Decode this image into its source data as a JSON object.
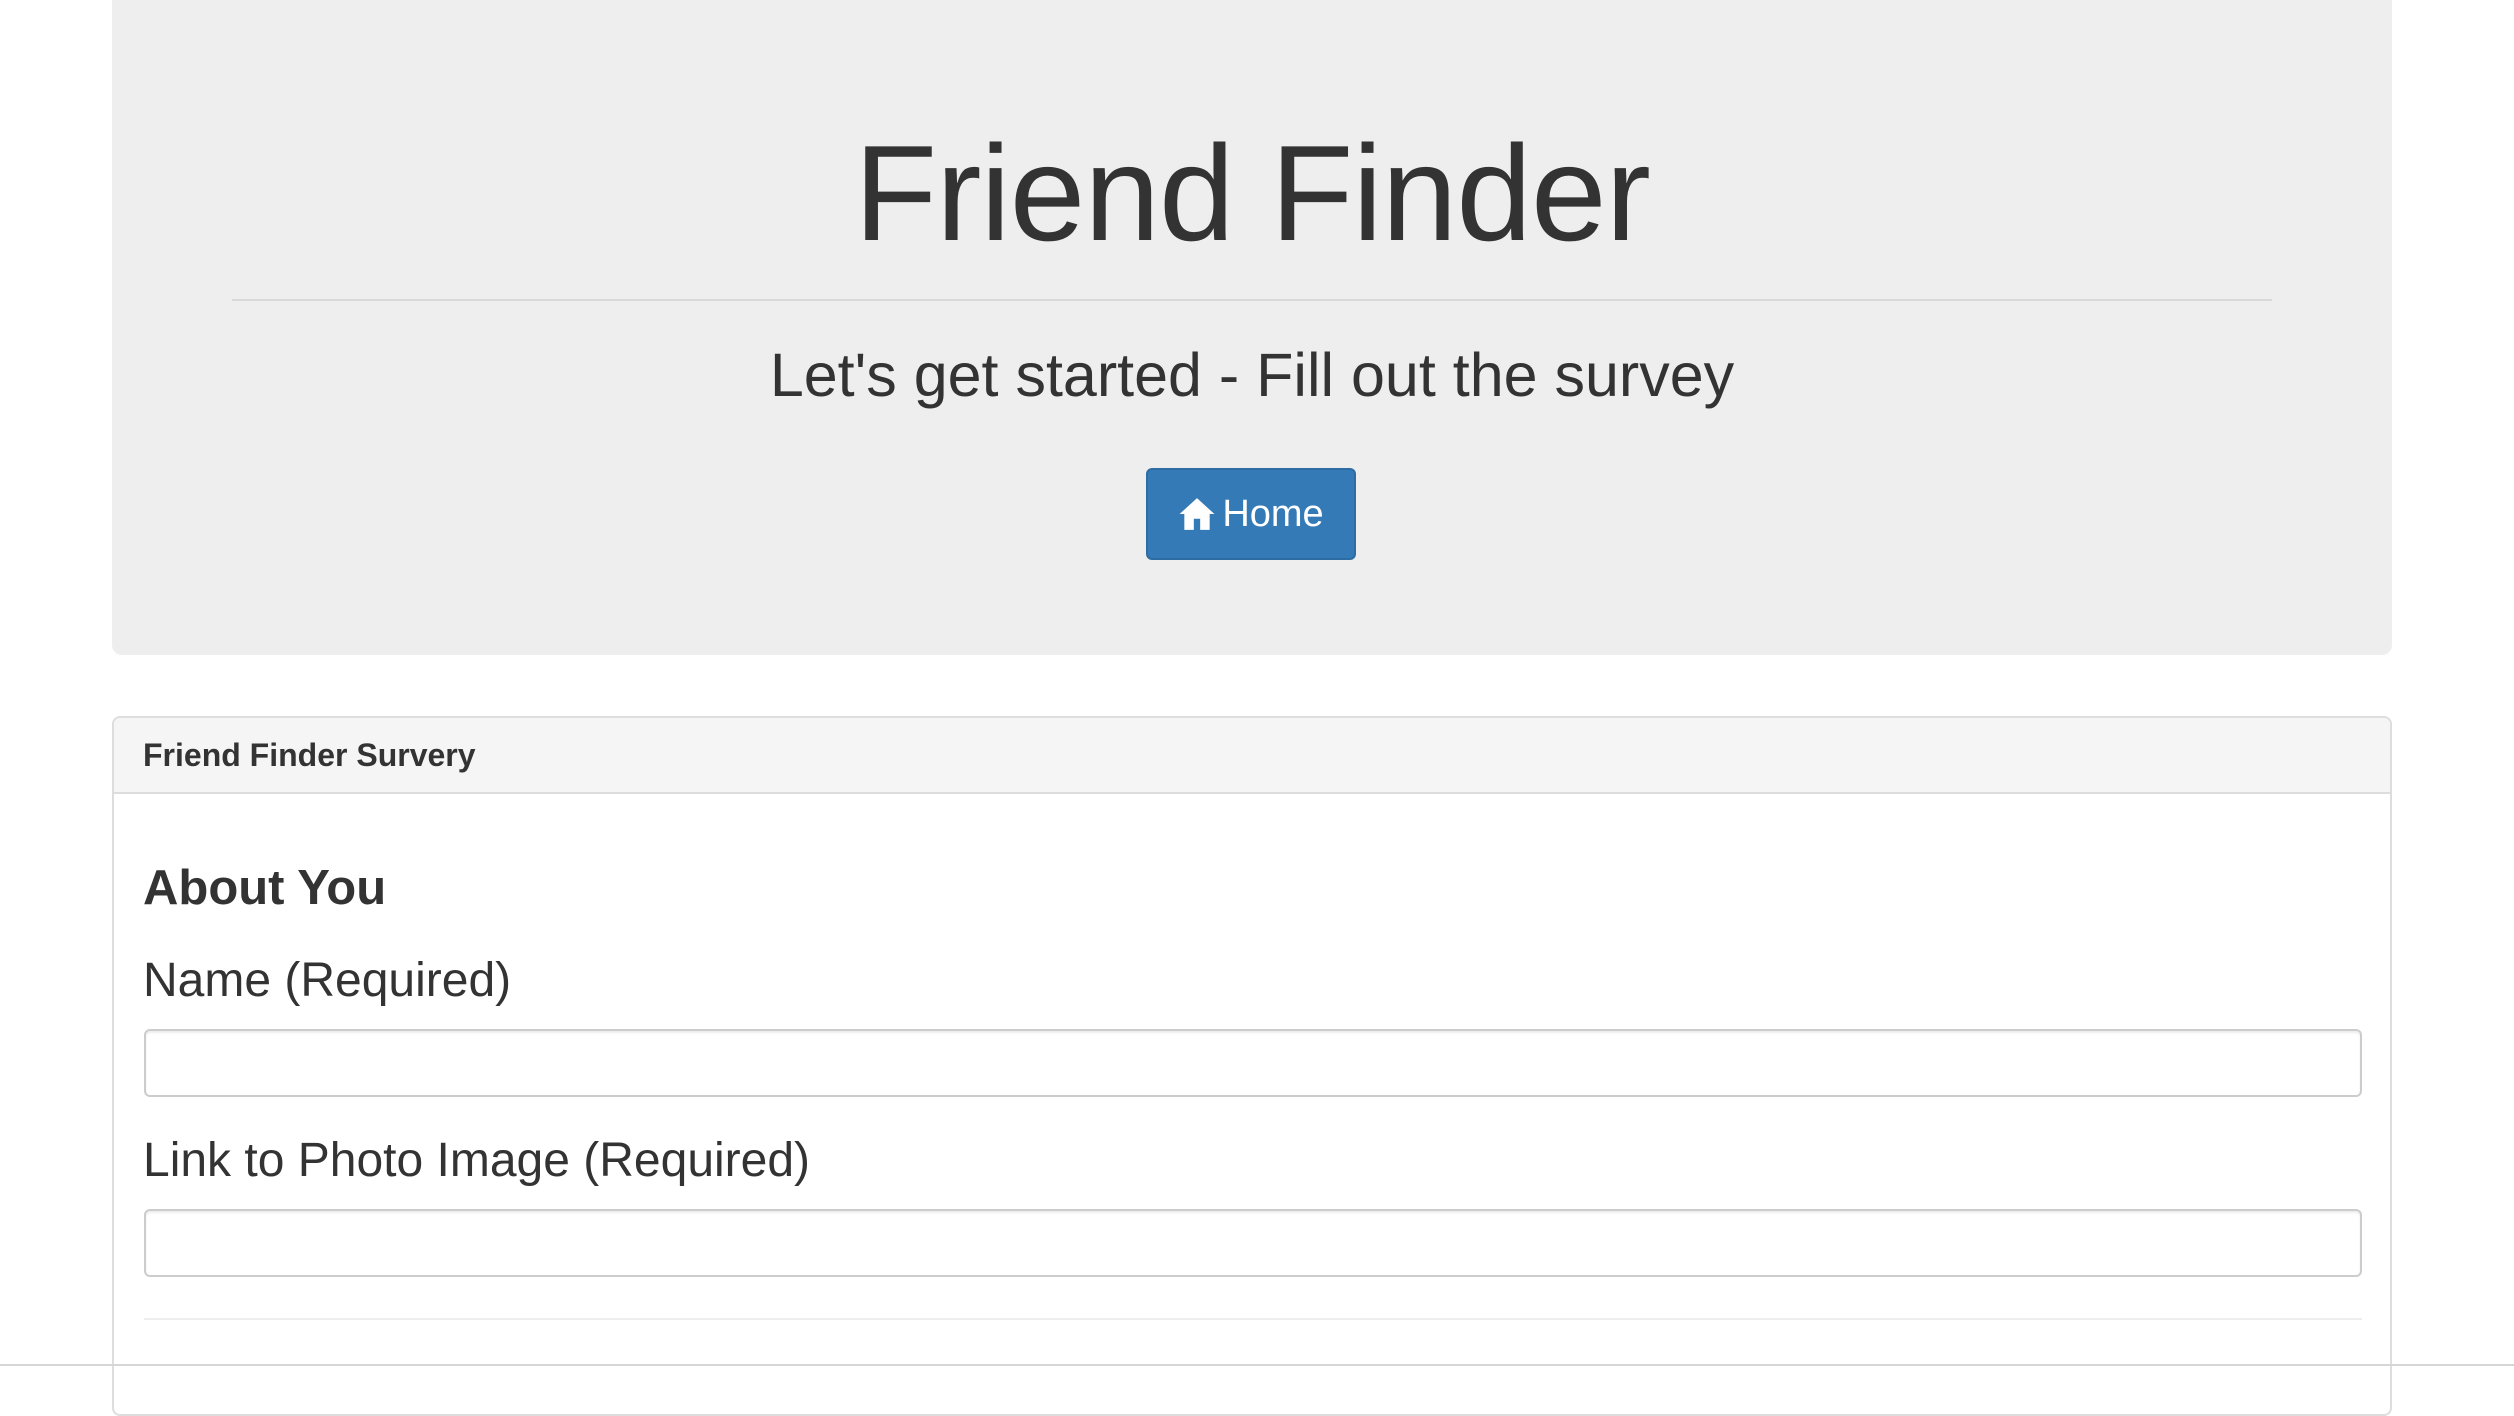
{
  "header": {
    "title": "Friend Finder",
    "subtitle": "Let's get started - Fill out the survey",
    "home_button": {
      "label": "Home",
      "icon": "home-icon"
    }
  },
  "survey_panel": {
    "heading": "Friend Finder Survery",
    "section_title": "About You",
    "fields": [
      {
        "label": "Name (Required)",
        "value": "",
        "placeholder": ""
      },
      {
        "label": "Link to Photo Image (Required)",
        "value": "",
        "placeholder": ""
      }
    ]
  },
  "colors": {
    "jumbotron_bg": "#eeeeee",
    "primary_button": "#337ab7",
    "text": "#333333",
    "panel_heading_bg": "#f5f5f5"
  }
}
